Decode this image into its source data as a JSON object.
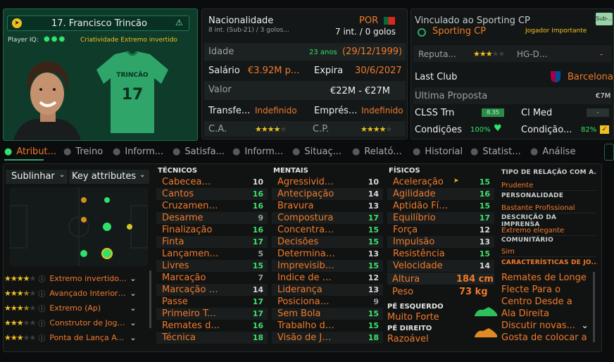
{
  "player": {
    "name": "17. Francisco Trincão",
    "player_iq_label": "Player IQ:",
    "player_iq_trait": "Criatividade  Extremo invertido",
    "shirt_name": "TRINCÃO",
    "shirt_number": "17"
  },
  "nationality": {
    "label": "Nacionalidade",
    "caps": "8 int. (Sub-21) / 3 golos...",
    "country": "POR",
    "senior_caps": "7 int. / 0 golos"
  },
  "bio": {
    "age_label": "Idade",
    "age_years": "23 anos",
    "dob": "(29/12/1999)",
    "salary_label": "Salário",
    "salary": "€3.92M p...",
    "expires_label": "Expira",
    "expires": "30/6/2027",
    "value_label": "Valor",
    "value": "€22M - €27M",
    "transfer_label": "Transfe...",
    "transfer": "Indefinido",
    "loan_label": "Emprés...",
    "loan": "Indefinido",
    "ca_label": "C.A.",
    "ca_stars": 4,
    "pc_label": "C.P.",
    "pc_stars": 4
  },
  "contract": {
    "linked_label": "Vinculado ao Sporting CP",
    "club": "Sporting CP",
    "sub_badge": "Sub-...",
    "status": "Jogador Importante",
    "reputation_label": "Reputa...",
    "reputation_stars": 3,
    "hg_label": "HG-D...",
    "hg_value": "-",
    "last_club_label": "Last Club",
    "last_club": "Barcelona",
    "last_offer_label": "Ultima Proposta",
    "last_offer": "€7M",
    "clss_label": "CLSS Trn",
    "clss_value": "8.35",
    "clmed_label": "Cl Med",
    "clmed_value": "-",
    "conditions_label": "Condições",
    "conditions_value": "100%",
    "condition2_label": "Condição...",
    "condition2_value": "82%"
  },
  "tabs": [
    "Atribut...",
    "Treino",
    "Inform...",
    "Satisfa...",
    "Inform...",
    "Situaç...",
    "Relató...",
    "Historial",
    "Statist...",
    "Análise"
  ],
  "highlight": {
    "dropdown": "Sublinhar",
    "key_attributes": "Key attributes"
  },
  "roles": [
    {
      "name": "Extremo invertido (...",
      "stars": 4
    },
    {
      "name": "Avançado Interior (...",
      "stars": 3.5
    },
    {
      "name": "Extremo (Ap)",
      "stars": 3.5
    },
    {
      "name": "Construtor de Jogo...",
      "stars": 3
    },
    {
      "name": "Ponta de Lança A...",
      "stars": 3
    }
  ],
  "technical": {
    "title": "TÉCNICOS",
    "items": [
      {
        "name": "Cabeceame...",
        "value": "10"
      },
      {
        "name": "Cantos",
        "value": "16"
      },
      {
        "name": "Cruzament...",
        "value": "16"
      },
      {
        "name": "Desarme",
        "value": "9"
      },
      {
        "name": "Finalização",
        "value": "16"
      },
      {
        "name": "Finta",
        "value": "17"
      },
      {
        "name": "Lançament...",
        "value": "5"
      },
      {
        "name": "Livres",
        "value": "15"
      },
      {
        "name": "Marcação",
        "value": "7"
      },
      {
        "name": "Marcação d...",
        "value": "14"
      },
      {
        "name": "Passe",
        "value": "17"
      },
      {
        "name": "Primeiro To...",
        "value": "17"
      },
      {
        "name": "Remates d...",
        "value": "16"
      },
      {
        "name": "Técnica",
        "value": "18"
      }
    ]
  },
  "mental": {
    "title": "MENTAIS",
    "items": [
      {
        "name": "Agressivida...",
        "value": "10"
      },
      {
        "name": "Antecipação",
        "value": "14"
      },
      {
        "name": "Bravura",
        "value": "13"
      },
      {
        "name": "Compostura",
        "value": "17"
      },
      {
        "name": "Concentraç...",
        "value": "15"
      },
      {
        "name": "Decisões",
        "value": "15"
      },
      {
        "name": "Determinaç...",
        "value": "13"
      },
      {
        "name": "Imprevisibil...",
        "value": "15"
      },
      {
        "name": "Índice de Tr...",
        "value": "12"
      },
      {
        "name": "Liderança",
        "value": "13"
      },
      {
        "name": "Posicionam...",
        "value": "9"
      },
      {
        "name": "Sem Bola",
        "value": "15"
      },
      {
        "name": "Trabalho de...",
        "value": "15"
      },
      {
        "name": "Visão de Jogo",
        "value": "18"
      }
    ]
  },
  "physical": {
    "title": "FÍSICOS",
    "items": [
      {
        "name": "Aceleração",
        "value": "15"
      },
      {
        "name": "Agilidade",
        "value": "16"
      },
      {
        "name": "Aptidão Físi...",
        "value": "15"
      },
      {
        "name": "Equilíbrio",
        "value": "17"
      },
      {
        "name": "Força",
        "value": "12"
      },
      {
        "name": "Impulsão",
        "value": "13"
      },
      {
        "name": "Resistência",
        "value": "15"
      },
      {
        "name": "Velocidade",
        "value": "14"
      }
    ],
    "height_label": "Altura",
    "height": "184 cm",
    "weight_label": "Peso",
    "weight": "73 kg",
    "left_foot_label": "PÉ ESQUERDO",
    "left_foot": "Muito Forte",
    "right_foot_label": "PÉ DIREITO",
    "right_foot": "Razoável"
  },
  "info": {
    "relation_title": "TIPO DE RELAÇÃO COM A...",
    "relation": "Prudente",
    "personality_title": "PERSONALIDADE",
    "personality": "Bastante Profissional",
    "press_title": "DESCRIÇÃO DA IMPRENSA",
    "press": "Extremo elegante",
    "community_title": "COMUNITÁRIO",
    "community": "Sim",
    "traits_title": "CARACTERÍSTICAS DE JO...",
    "traits": [
      "Remates de Longe",
      "Flecte Para o Centro Desde a Ala Direita",
      "Discutir novas...",
      "Gosta de colocar a"
    ]
  }
}
